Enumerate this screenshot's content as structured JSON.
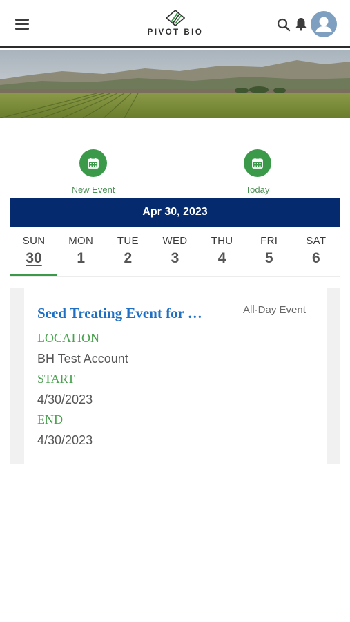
{
  "header": {
    "logo_text": "PIVOT BIO"
  },
  "actions": {
    "new_event_label": "New Event",
    "today_label": "Today"
  },
  "calendar": {
    "current_date": "Apr 30, 2023",
    "days": [
      {
        "name": "SUN",
        "num": "30",
        "selected": true
      },
      {
        "name": "MON",
        "num": "1"
      },
      {
        "name": "TUE",
        "num": "2"
      },
      {
        "name": "WED",
        "num": "3"
      },
      {
        "name": "THU",
        "num": "4"
      },
      {
        "name": "FRI",
        "num": "5"
      },
      {
        "name": "SAT",
        "num": "6"
      }
    ]
  },
  "event": {
    "title": "Seed Treating Event for …",
    "badge": "All-Day Event",
    "location_label": "LOCATION",
    "location": "BH Test Account",
    "start_label": "START",
    "start": "4/30/2023",
    "end_label": "END",
    "end": "4/30/2023"
  },
  "colors": {
    "accent_green": "#3b9a4a",
    "navy": "#062a6e",
    "link_blue": "#1f6fc4"
  },
  "icons": {
    "menu": "hamburger-menu-icon",
    "search": "search-icon",
    "bell": "bell-icon",
    "avatar": "user-avatar-icon",
    "calendar": "calendar-icon"
  }
}
